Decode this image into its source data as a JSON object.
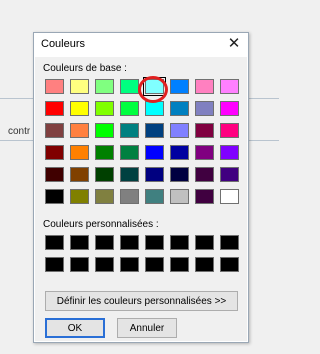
{
  "background": {
    "partial_text": "contr"
  },
  "dialog": {
    "title": "Couleurs",
    "close_glyph": "✕",
    "basic_label": "Couleurs de base :",
    "custom_label": "Couleurs personnalisées :",
    "define_button": "Définir les couleurs personnalisées >>",
    "ok_button": "OK",
    "cancel_button": "Annuler",
    "selected_basic_index": 4,
    "basic_colors": [
      "#ff8080",
      "#ffff80",
      "#80ff80",
      "#00ff80",
      "#80ffff",
      "#0080ff",
      "#ff80c0",
      "#ff80ff",
      "#ff0000",
      "#ffff00",
      "#80ff00",
      "#00ff40",
      "#00ffff",
      "#0080c0",
      "#8080c0",
      "#ff00ff",
      "#804040",
      "#ff8040",
      "#00ff00",
      "#008080",
      "#004080",
      "#8080ff",
      "#800040",
      "#ff0080",
      "#800000",
      "#ff8000",
      "#008000",
      "#008040",
      "#0000ff",
      "#0000a0",
      "#800080",
      "#8000ff",
      "#400000",
      "#804000",
      "#004000",
      "#004040",
      "#000080",
      "#000040",
      "#400040",
      "#400080",
      "#000000",
      "#808000",
      "#808040",
      "#808080",
      "#408080",
      "#c0c0c0",
      "#400040",
      "#ffffff"
    ],
    "custom_colors": [
      "#000000",
      "#000000",
      "#000000",
      "#000000",
      "#000000",
      "#000000",
      "#000000",
      "#000000",
      "#000000",
      "#000000",
      "#000000",
      "#000000",
      "#000000",
      "#000000",
      "#000000",
      "#000000"
    ]
  }
}
